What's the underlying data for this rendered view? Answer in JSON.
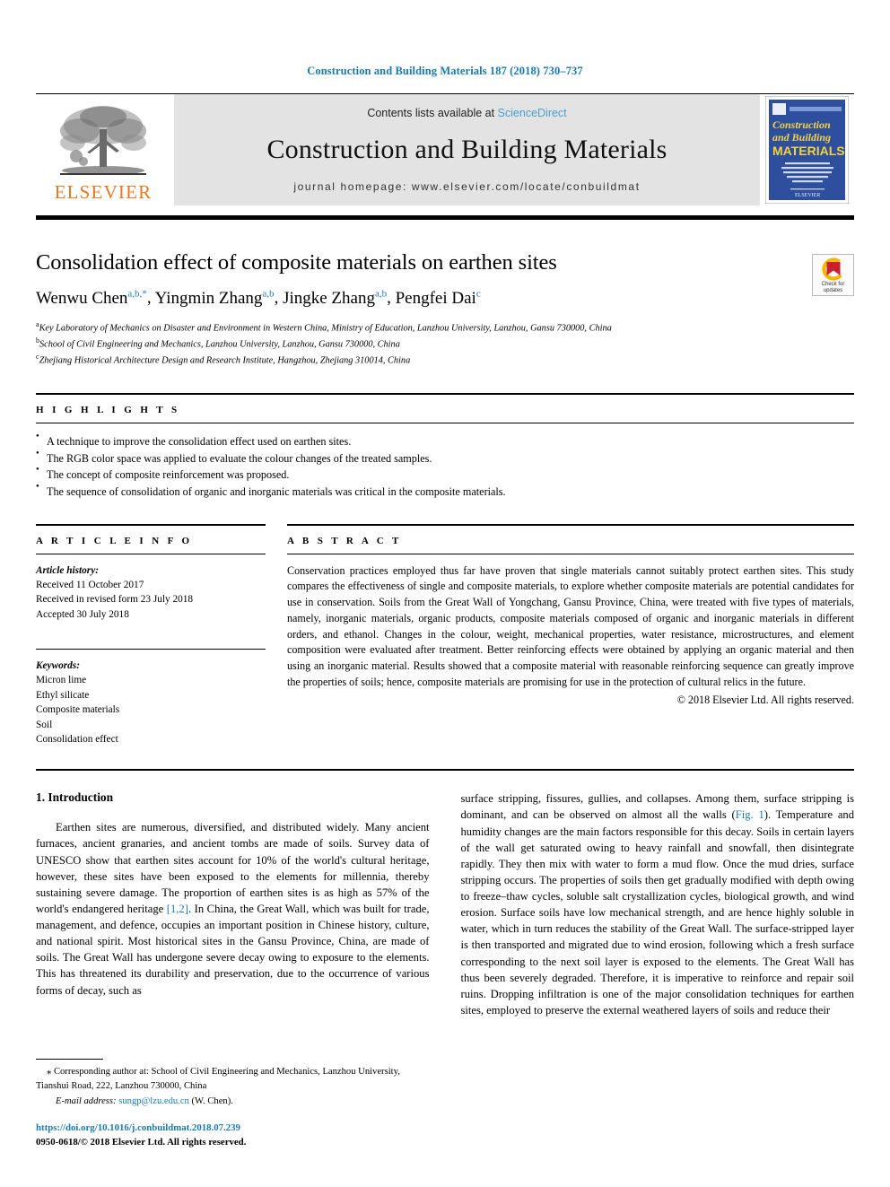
{
  "running_head": "Construction and Building Materials 187 (2018) 730–737",
  "masthead": {
    "publisher_name": "ELSEVIER",
    "contents_prefix": "Contents lists available at ",
    "contents_link": "ScienceDirect",
    "journal_title": "Construction and Building Materials",
    "journal_homepage": "journal homepage: www.elsevier.com/locate/conbuildmat",
    "cover": {
      "line1": "Construction",
      "line2": "and Building",
      "line3": "MATERIALS",
      "blurb": "An international journal dedicated to the investigation and innovative use of materials in construction and repair"
    }
  },
  "article": {
    "title": "Consolidation effect of composite materials on earthen sites",
    "authors": [
      {
        "name": "Wenwu Chen",
        "marks": "a,b,*"
      },
      {
        "name": "Yingmin Zhang",
        "marks": "a,b"
      },
      {
        "name": "Jingke Zhang",
        "marks": "a,b"
      },
      {
        "name": "Pengfei Dai",
        "marks": "c"
      }
    ],
    "affiliations": [
      {
        "mark": "a",
        "text": "Key Laboratory of Mechanics on Disaster and Environment in Western China, Ministry of Education, Lanzhou University, Lanzhou, Gansu 730000, China"
      },
      {
        "mark": "b",
        "text": "School of Civil Engineering and Mechanics, Lanzhou University, Lanzhou, Gansu 730000, China"
      },
      {
        "mark": "c",
        "text": "Zhejiang Historical Architecture Design and Research Institute, Hangzhou, Zhejiang 310014, China"
      }
    ],
    "crossmark_label_line1": "Check for",
    "crossmark_label_line2": "updates"
  },
  "highlights": {
    "heading": "H I G H L I G H T S",
    "items": [
      "A technique to improve the consolidation effect used on earthen sites.",
      "The RGB color space was applied to evaluate the colour changes of the treated samples.",
      "The concept of composite reinforcement was proposed.",
      "The sequence of consolidation of organic and inorganic materials was critical in the composite materials."
    ]
  },
  "article_info": {
    "heading": "A R T I C L E   I N F O",
    "history_label": "Article history:",
    "history": [
      "Received 11 October 2017",
      "Received in revised form 23 July 2018",
      "Accepted 30 July 2018"
    ],
    "keywords_label": "Keywords:",
    "keywords": [
      "Micron lime",
      "Ethyl silicate",
      "Composite materials",
      "Soil",
      "Consolidation effect"
    ]
  },
  "abstract": {
    "heading": "A B S T R A C T",
    "text": "Conservation practices employed thus far have proven that single materials cannot suitably protect earthen sites. This study compares the effectiveness of single and composite materials, to explore whether composite materials are potential candidates for use in conservation. Soils from the Great Wall of Yongchang, Gansu Province, China, were treated with five types of materials, namely, inorganic materials, organic products, composite materials composed of organic and inorganic materials in different orders, and ethanol. Changes in the colour, weight, mechanical properties, water resistance, microstructures, and element composition were evaluated after treatment. Better reinforcing effects were obtained by applying an organic material and then using an inorganic material. Results showed that a composite material with reasonable reinforcing sequence can greatly improve the properties of soils; hence, composite materials are promising for use in the protection of cultural relics in the future.",
    "copyright": "© 2018 Elsevier Ltd. All rights reserved."
  },
  "body": {
    "section_number_title": "1. Introduction",
    "left_para_1_a": "Earthen sites are numerous, diversified, and distributed widely. Many ancient furnaces, ancient granaries, and ancient tombs are made of soils. Survey data of UNESCO show that earthen sites account for 10% of the world's cultural heritage, however, these sites have been exposed to the elements for millennia, thereby sustaining severe damage. The proportion of earthen sites is as high as 57% of the world's endangered heritage ",
    "left_ref_1": "[1,2]",
    "left_para_1_b": ". In China, the Great Wall, which was built for trade, management, and defence, occupies an important position in Chinese history, culture, and national spirit. Most historical sites in the Gansu Province, China, are made of soils. The Great Wall has undergone severe decay owing to exposure to the elements. This has threatened its durability and preservation, due to the occurrence of various forms of decay, such as",
    "right_para_a": "surface stripping, fissures, gullies, and collapses. Among them, surface stripping is dominant, and can be observed on almost all the walls (",
    "right_ref_fig": "Fig. 1",
    "right_para_b": "). Temperature and humidity changes are the main factors responsible for this decay. Soils in certain layers of the wall get saturated owing to heavy rainfall and snowfall, then disintegrate rapidly. They then mix with water to form a mud flow. Once the mud dries, surface stripping occurs. The properties of soils then get gradually modified with depth owing to freeze–thaw cycles, soluble salt crystallization cycles, biological growth, and wind erosion. Surface soils have low mechanical strength, and are hence highly soluble in water, which in turn reduces the stability of the Great Wall. The surface-stripped layer is then transported and migrated due to wind erosion, following which a fresh surface corresponding to the next soil layer is exposed to the elements. The Great Wall has thus been severely degraded. Therefore, it is imperative to reinforce and repair soil ruins. Dropping infiltration is one of the major consolidation techniques for earthen sites, employed to preserve the external weathered layers of soils and reduce their"
  },
  "footnote": {
    "corresponding": "⁎ Corresponding author at: School of Civil Engineering and Mechanics, Lanzhou University, Tianshui Road, 222, Lanzhou 730000, China",
    "email_label": "E-mail address:",
    "email": "sungp@lzu.edu.cn",
    "email_suffix": "(W. Chen).",
    "doi": "https://doi.org/10.1016/j.conbuildmat.2018.07.239",
    "issn_line": "0950-0618/© 2018 Elsevier Ltd. All rights reserved."
  },
  "colors": {
    "link_blue": "#1a7aad",
    "sciencedirect_blue": "#4a9fd4",
    "elsevier_orange": "#E87722",
    "band_gray": "#e3e3e3",
    "cover_blue": "#2e4f9e"
  }
}
